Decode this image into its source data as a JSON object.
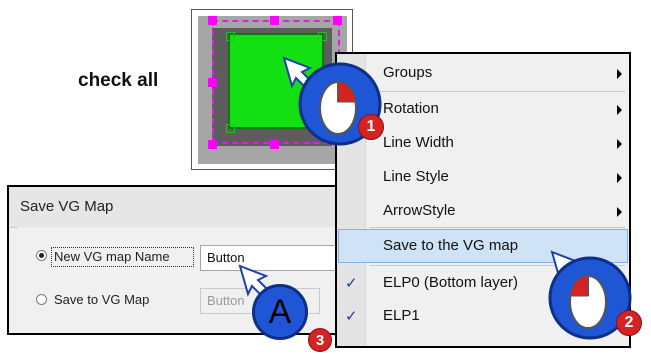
{
  "label": {
    "check_all": "check all"
  },
  "dialog": {
    "title": "Save VG Map",
    "option1_label": "New VG map Name",
    "option1_value": "Button",
    "option2_label": "Save to VG Map",
    "option2_value": "Button"
  },
  "menu": {
    "items": [
      {
        "label": "Groups",
        "submenu": true
      },
      {
        "label": "Rotation",
        "submenu": true
      },
      {
        "label": "Line Width",
        "submenu": true
      },
      {
        "label": "Line Style",
        "submenu": true
      },
      {
        "label": "ArrowStyle",
        "submenu": true
      },
      {
        "label": "Save to the VG map",
        "submenu": false,
        "highlighted": true
      },
      {
        "label": "ELP0 (Bottom layer)",
        "submenu": true,
        "checked": true
      },
      {
        "label": "ELP1",
        "submenu": false,
        "checked": true
      }
    ]
  },
  "badges": {
    "step1": "1",
    "step2": "2",
    "step3": "3"
  },
  "keyboard_icon": "A",
  "colors": {
    "object_fill": "#12e012",
    "selection": "#ff00ff",
    "highlight": "#cfe3f7",
    "badge": "#d52222",
    "mouse_button": "#1f56d6"
  }
}
